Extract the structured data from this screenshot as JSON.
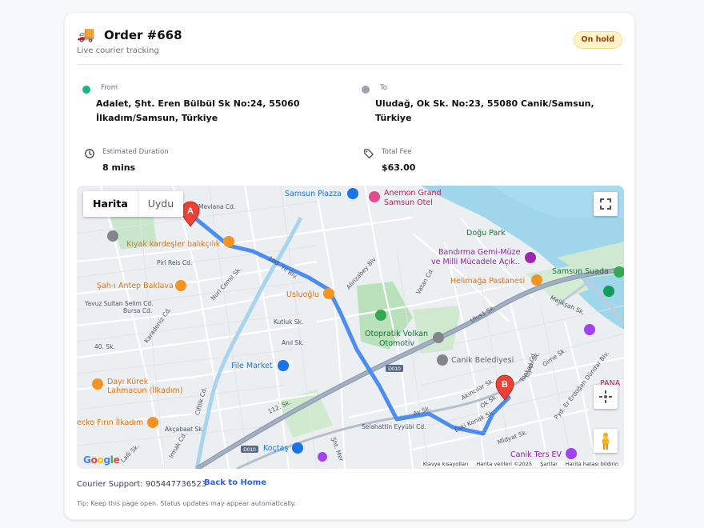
{
  "order": {
    "title": "Order #668",
    "subtitle": "Live courier tracking",
    "status": "On hold",
    "status_colors": {
      "bg": "#fef3c7",
      "text": "#92400e"
    }
  },
  "route": {
    "from_label": "From",
    "from_address": "Adalet, Şht. Eren Bülbül Sk No:24, 55060 İlkadım/Samsun, Türkiye",
    "to_label": "To",
    "to_address": "Uludağ, Ok Sk. No:23, 55080 Canik/Samsun, Türkiye",
    "from_color": "#10b981",
    "to_color": "#9ca3af"
  },
  "stats": {
    "duration_label": "Estimated Duration",
    "duration_value": "8 mins",
    "fee_label": "Total Fee",
    "fee_value": "$63.00"
  },
  "map": {
    "tab_map": "Harita",
    "tab_satellite": "Uydu",
    "marker_a": "A",
    "marker_b": "B",
    "credits": [
      "Klavye kısayolları",
      "Harita verileri ©2025",
      "Şartlar",
      "Harita hatası bildirin"
    ],
    "google": "Google",
    "places": [
      {
        "text": "Samsun Piazza",
        "color": "#1a73e8"
      },
      {
        "text": "Anemon Grand",
        "color": "#c2185b"
      },
      {
        "text": "Samsun Otel",
        "color": "#c2185b"
      },
      {
        "text": "Doğu Park",
        "color": "#137333"
      },
      {
        "text": "Kıyak kardeşler balıkçılık",
        "color": "#e8710a"
      },
      {
        "text": "Bandırma Gemi-Müze",
        "color": "#8e24aa"
      },
      {
        "text": "ve Milli Mücadele Açık..",
        "color": "#8e24aa"
      },
      {
        "text": "Samsun Suada",
        "color": "#137333"
      },
      {
        "text": "Helimağa Pastanesi",
        "color": "#e8710a"
      },
      {
        "text": "Şah-ı Antep Baklava",
        "color": "#e8710a"
      },
      {
        "text": "Usluoğlu",
        "color": "#e8710a"
      },
      {
        "text": "Otopratik Volkan",
        "color": "#137333"
      },
      {
        "text": "Otomotiv",
        "color": "#137333"
      },
      {
        "text": "Canik Belediyesi",
        "color": "#5f6368"
      },
      {
        "text": "File Market",
        "color": "#1a73e8"
      },
      {
        "text": "Dayı Kürek",
        "color": "#e8710a"
      },
      {
        "text": "Lahmacun (İlkadım)",
        "color": "#e8710a"
      },
      {
        "text": "ecko Fırın İlkadım",
        "color": "#e8710a"
      },
      {
        "text": "Koçtaş",
        "color": "#1a73e8"
      },
      {
        "text": "Canik Ters EV",
        "color": "#8e24aa"
      },
      {
        "text": "PANA",
        "color": "#c2185b"
      }
    ],
    "streets": [
      "Mevlana Cd.",
      "Piri Reis Cd.",
      "Yavuz Sultan Selim Cd.",
      "Bursa Cd.",
      "Karadeniz Cd.",
      "100. Yıl Blv.",
      "Alirizabey Blv",
      "Vatan Cd.",
      "Kutluk Sk.",
      "Anıl Sk.",
      "40. Sk.",
      "112. Sk.",
      "Akçabaat Sk.",
      "Topkapı Sk.",
      "Akıncılar Sk.",
      "Ok Sk.",
      "Ay Sk.",
      "Eski Konak Sk.",
      "Mİdyat Sk.",
      "Pyd. Er Erdoğan Dündar Blv.",
      "Ulus1 Sk.",
      "Melikşah Sk.",
      "Girne Sk.",
      "Topel Cd.",
      "Selahattin Eyyübi Cd.",
      "Ciftlik Cd.",
      "Irmak Cd.",
      "Nuri Cemil Sk.",
      "Lalli Sk.",
      "D010",
      "Şht. Mer"
    ]
  },
  "footer": {
    "support": "Courier Support: 905447736523",
    "back": "Back to Home",
    "tip": "Tip: Keep this page open. Status updates may appear automatically."
  }
}
